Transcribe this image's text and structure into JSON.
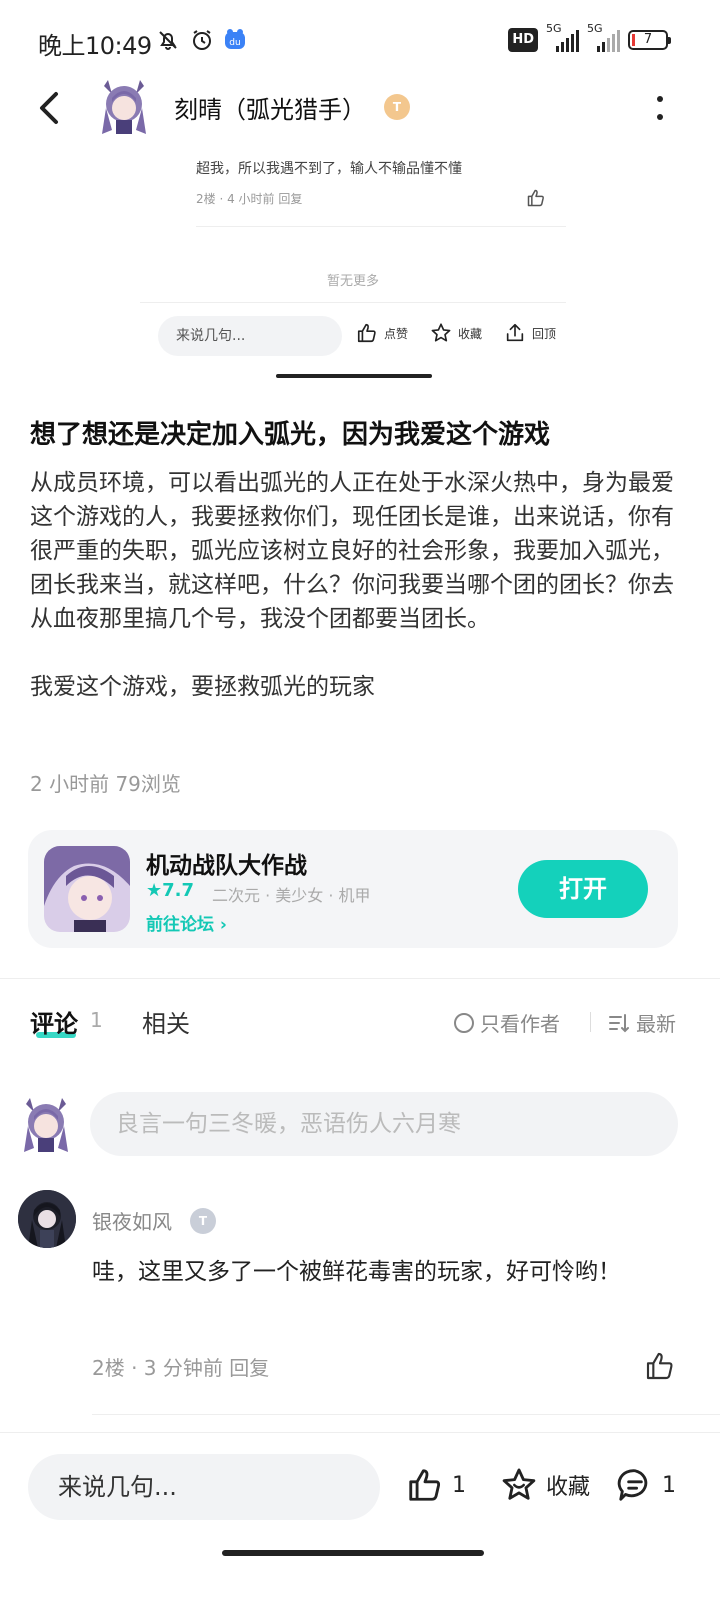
{
  "status_bar": {
    "time": "晚上10:49",
    "hd_label": "HD",
    "net1": "5G",
    "net2": "5G",
    "battery": "7"
  },
  "header": {
    "title": "刻晴（弧光猎手）",
    "level_badge": "T"
  },
  "preview": {
    "comment_text": "超我，所以我遇不到了，输人不输品懂不懂",
    "comment_meta": "2楼 · 4 小时前  回复",
    "no_more": "暂无更多",
    "input_placeholder": "来说几句...",
    "like_label": "点赞",
    "fav_label": "收藏",
    "top_label": "回顶"
  },
  "post": {
    "title": "想了想还是决定加入弧光，因为我爱这个游戏",
    "paragraph1": "从成员环境，可以看出弧光的人正在处于水深火热中，身为最爱这个游戏的人，我要拯救你们，现任团长是谁，出来说话，你有很严重的失职，弧光应该树立良好的社会形象，我要加入弧光，团长我来当，就这样吧，什么？你问我要当哪个团的团长？你去从血夜那里搞几个号，我没个团都要当团长。",
    "paragraph2": "我爱这个游戏，要拯救弧光的玩家",
    "meta": "2 小时前  79浏览"
  },
  "game_card": {
    "name": "机动战队大作战",
    "rating": "★7.7",
    "tags": "二次元 · 美少女 · 机甲",
    "forum_link": "前往论坛 ›",
    "open_button": "打开"
  },
  "tabs": {
    "comment_label": "评论",
    "comment_count": "1",
    "related_label": "相关",
    "only_author": "只看作者",
    "sort_label": "最新"
  },
  "comment_input": {
    "placeholder": "良言一句三冬暖，恶语伤人六月寒"
  },
  "comment": {
    "author": "银夜如风",
    "badge": "T",
    "text": "哇，这里又多了一个被鲜花毒害的玩家，好可怜哟！",
    "meta": "2楼 · 3 分钟前  回复"
  },
  "bottom_bar": {
    "input_placeholder": "来说几句...",
    "like_count": "1",
    "fav_label": "收藏",
    "comment_count": "1"
  },
  "colors": {
    "accent": "#14d1bb",
    "gold_badge": "#f3c78e",
    "silver_badge": "#c9ced8"
  }
}
